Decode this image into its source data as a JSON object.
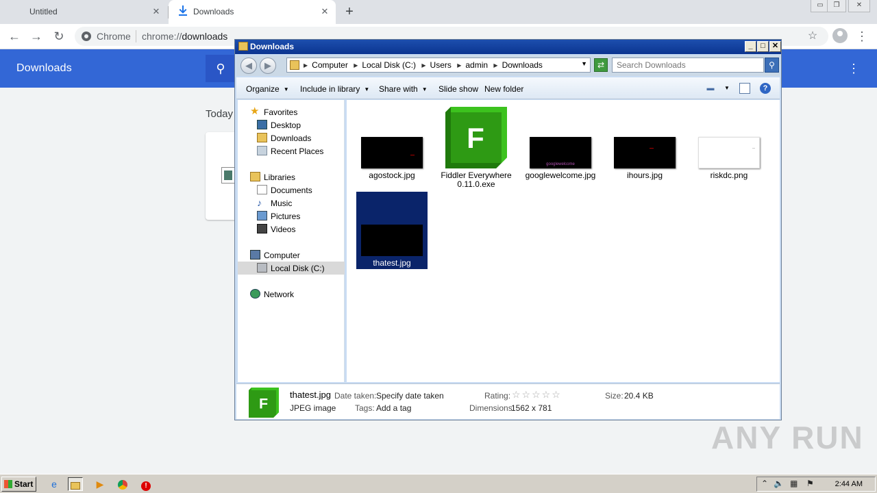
{
  "chrome": {
    "tabs": [
      {
        "title": "Untitled"
      },
      {
        "title": "Downloads"
      }
    ],
    "new_tab": "+",
    "omnibox": {
      "site": "Chrome",
      "url_scheme": "chrome://",
      "url_host": "downloads"
    },
    "page": {
      "header_title": "Downloads",
      "section": "Today"
    }
  },
  "explorer": {
    "title": "Downloads",
    "breadcrumbs": [
      "Computer",
      "Local Disk (C:)",
      "Users",
      "admin",
      "Downloads"
    ],
    "search_placeholder": "Search Downloads",
    "commands": {
      "organize": "Organize",
      "include": "Include in library",
      "share": "Share with",
      "slideshow": "Slide show",
      "newfolder": "New folder"
    },
    "nav": {
      "favorites": "Favorites",
      "desktop": "Desktop",
      "downloads": "Downloads",
      "recent": "Recent Places",
      "libraries": "Libraries",
      "documents": "Documents",
      "music": "Music",
      "pictures": "Pictures",
      "videos": "Videos",
      "computer": "Computer",
      "localdisk": "Local Disk (C:)",
      "network": "Network"
    },
    "files": [
      {
        "name": "agostock.jpg"
      },
      {
        "name": "Fiddler Everywhere 0.11.0.exe"
      },
      {
        "name": "googlewelcome.jpg",
        "thumb_text": "googlewelcome"
      },
      {
        "name": "ihours.jpg"
      },
      {
        "name": "riskdc.png"
      },
      {
        "name": "thatest.jpg"
      }
    ],
    "details": {
      "name": "thatest.jpg",
      "type": "JPEG image",
      "date_taken_label": "Date taken:",
      "date_taken_value": "Specify date taken",
      "tags_label": "Tags:",
      "tags_value": "Add a tag",
      "rating_label": "Rating:",
      "dimensions_label": "Dimensions:",
      "dimensions_value": "1562 x 781",
      "size_label": "Size:",
      "size_value": "20.4 KB"
    }
  },
  "taskbar": {
    "start": "Start",
    "clock": "2:44 AM"
  },
  "watermark": "ANY RUN",
  "colors": {
    "chrome_header": "#3367d6",
    "fiddler_green": "#3cc21e",
    "selection": "#0a246a"
  }
}
